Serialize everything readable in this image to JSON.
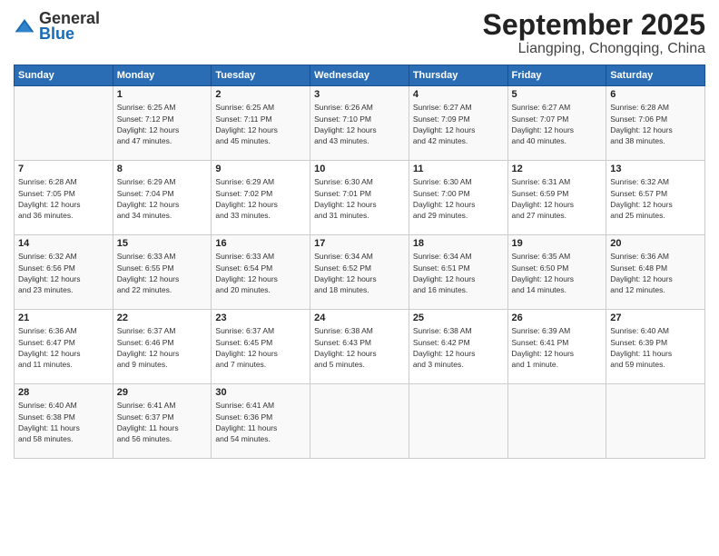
{
  "header": {
    "logo_general": "General",
    "logo_blue": "Blue",
    "month_title": "September 2025",
    "location": "Liangping, Chongqing, China"
  },
  "weekdays": [
    "Sunday",
    "Monday",
    "Tuesday",
    "Wednesday",
    "Thursday",
    "Friday",
    "Saturday"
  ],
  "weeks": [
    [
      {
        "day": "",
        "info": ""
      },
      {
        "day": "1",
        "info": "Sunrise: 6:25 AM\nSunset: 7:12 PM\nDaylight: 12 hours\nand 47 minutes."
      },
      {
        "day": "2",
        "info": "Sunrise: 6:25 AM\nSunset: 7:11 PM\nDaylight: 12 hours\nand 45 minutes."
      },
      {
        "day": "3",
        "info": "Sunrise: 6:26 AM\nSunset: 7:10 PM\nDaylight: 12 hours\nand 43 minutes."
      },
      {
        "day": "4",
        "info": "Sunrise: 6:27 AM\nSunset: 7:09 PM\nDaylight: 12 hours\nand 42 minutes."
      },
      {
        "day": "5",
        "info": "Sunrise: 6:27 AM\nSunset: 7:07 PM\nDaylight: 12 hours\nand 40 minutes."
      },
      {
        "day": "6",
        "info": "Sunrise: 6:28 AM\nSunset: 7:06 PM\nDaylight: 12 hours\nand 38 minutes."
      }
    ],
    [
      {
        "day": "7",
        "info": "Sunrise: 6:28 AM\nSunset: 7:05 PM\nDaylight: 12 hours\nand 36 minutes."
      },
      {
        "day": "8",
        "info": "Sunrise: 6:29 AM\nSunset: 7:04 PM\nDaylight: 12 hours\nand 34 minutes."
      },
      {
        "day": "9",
        "info": "Sunrise: 6:29 AM\nSunset: 7:02 PM\nDaylight: 12 hours\nand 33 minutes."
      },
      {
        "day": "10",
        "info": "Sunrise: 6:30 AM\nSunset: 7:01 PM\nDaylight: 12 hours\nand 31 minutes."
      },
      {
        "day": "11",
        "info": "Sunrise: 6:30 AM\nSunset: 7:00 PM\nDaylight: 12 hours\nand 29 minutes."
      },
      {
        "day": "12",
        "info": "Sunrise: 6:31 AM\nSunset: 6:59 PM\nDaylight: 12 hours\nand 27 minutes."
      },
      {
        "day": "13",
        "info": "Sunrise: 6:32 AM\nSunset: 6:57 PM\nDaylight: 12 hours\nand 25 minutes."
      }
    ],
    [
      {
        "day": "14",
        "info": "Sunrise: 6:32 AM\nSunset: 6:56 PM\nDaylight: 12 hours\nand 23 minutes."
      },
      {
        "day": "15",
        "info": "Sunrise: 6:33 AM\nSunset: 6:55 PM\nDaylight: 12 hours\nand 22 minutes."
      },
      {
        "day": "16",
        "info": "Sunrise: 6:33 AM\nSunset: 6:54 PM\nDaylight: 12 hours\nand 20 minutes."
      },
      {
        "day": "17",
        "info": "Sunrise: 6:34 AM\nSunset: 6:52 PM\nDaylight: 12 hours\nand 18 minutes."
      },
      {
        "day": "18",
        "info": "Sunrise: 6:34 AM\nSunset: 6:51 PM\nDaylight: 12 hours\nand 16 minutes."
      },
      {
        "day": "19",
        "info": "Sunrise: 6:35 AM\nSunset: 6:50 PM\nDaylight: 12 hours\nand 14 minutes."
      },
      {
        "day": "20",
        "info": "Sunrise: 6:36 AM\nSunset: 6:48 PM\nDaylight: 12 hours\nand 12 minutes."
      }
    ],
    [
      {
        "day": "21",
        "info": "Sunrise: 6:36 AM\nSunset: 6:47 PM\nDaylight: 12 hours\nand 11 minutes."
      },
      {
        "day": "22",
        "info": "Sunrise: 6:37 AM\nSunset: 6:46 PM\nDaylight: 12 hours\nand 9 minutes."
      },
      {
        "day": "23",
        "info": "Sunrise: 6:37 AM\nSunset: 6:45 PM\nDaylight: 12 hours\nand 7 minutes."
      },
      {
        "day": "24",
        "info": "Sunrise: 6:38 AM\nSunset: 6:43 PM\nDaylight: 12 hours\nand 5 minutes."
      },
      {
        "day": "25",
        "info": "Sunrise: 6:38 AM\nSunset: 6:42 PM\nDaylight: 12 hours\nand 3 minutes."
      },
      {
        "day": "26",
        "info": "Sunrise: 6:39 AM\nSunset: 6:41 PM\nDaylight: 12 hours\nand 1 minute."
      },
      {
        "day": "27",
        "info": "Sunrise: 6:40 AM\nSunset: 6:39 PM\nDaylight: 11 hours\nand 59 minutes."
      }
    ],
    [
      {
        "day": "28",
        "info": "Sunrise: 6:40 AM\nSunset: 6:38 PM\nDaylight: 11 hours\nand 58 minutes."
      },
      {
        "day": "29",
        "info": "Sunrise: 6:41 AM\nSunset: 6:37 PM\nDaylight: 11 hours\nand 56 minutes."
      },
      {
        "day": "30",
        "info": "Sunrise: 6:41 AM\nSunset: 6:36 PM\nDaylight: 11 hours\nand 54 minutes."
      },
      {
        "day": "",
        "info": ""
      },
      {
        "day": "",
        "info": ""
      },
      {
        "day": "",
        "info": ""
      },
      {
        "day": "",
        "info": ""
      }
    ]
  ]
}
